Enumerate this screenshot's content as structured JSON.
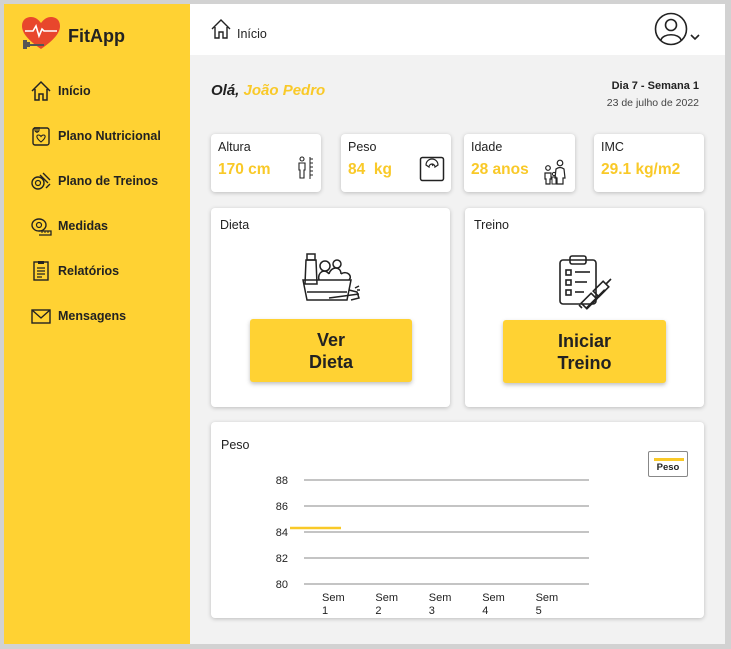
{
  "brand": {
    "name": "FitApp"
  },
  "sidebar": {
    "items": [
      {
        "label": "Início",
        "icon": "home-icon"
      },
      {
        "label": "Plano Nutricional",
        "icon": "nutrition-plan-icon"
      },
      {
        "label": "Plano de Treinos",
        "icon": "workout-plan-icon"
      },
      {
        "label": "Medidas",
        "icon": "tape-measure-icon"
      },
      {
        "label": "Relatórios",
        "icon": "report-icon"
      },
      {
        "label": "Mensagens",
        "icon": "envelope-icon"
      }
    ]
  },
  "header": {
    "breadcrumb": "Início"
  },
  "greeting": {
    "prefix": "Olá,",
    "name": "João Pedro"
  },
  "day": {
    "label": "Dia 7 - Semana 1",
    "date": "23 de julho de 2022"
  },
  "stats": [
    {
      "title": "Altura",
      "value": "170 cm",
      "icon": "height-icon"
    },
    {
      "title": "Peso",
      "value": "84  kg",
      "icon": "scale-icon"
    },
    {
      "title": "Idade",
      "value": "28 anos",
      "icon": "family-icon"
    },
    {
      "title": "IMC",
      "value": "29.1 kg/m2",
      "icon": ""
    }
  ],
  "diet": {
    "title": "Dieta",
    "button": "Ver\nDieta",
    "icon": "groceries-icon"
  },
  "workout": {
    "title": "Treino",
    "button": "Iniciar\nTreino",
    "icon": "clipboard-dumbbell-icon"
  },
  "colors": {
    "accent": "#ffd233",
    "highlight": "#f9c928"
  },
  "chart_data": {
    "type": "line",
    "title": "Peso",
    "categories": [
      "Sem\n1",
      "Sem\n2",
      "Sem\n3",
      "Sem\n4",
      "Sem\n5"
    ],
    "yticks": [
      "88",
      "86",
      "84",
      "82",
      "80"
    ],
    "ylim": [
      80,
      88
    ],
    "series": [
      {
        "name": "Peso",
        "x": [
          "Sem\n1"
        ],
        "values": [
          84
        ]
      }
    ],
    "grid": true,
    "legend": "top-right"
  }
}
